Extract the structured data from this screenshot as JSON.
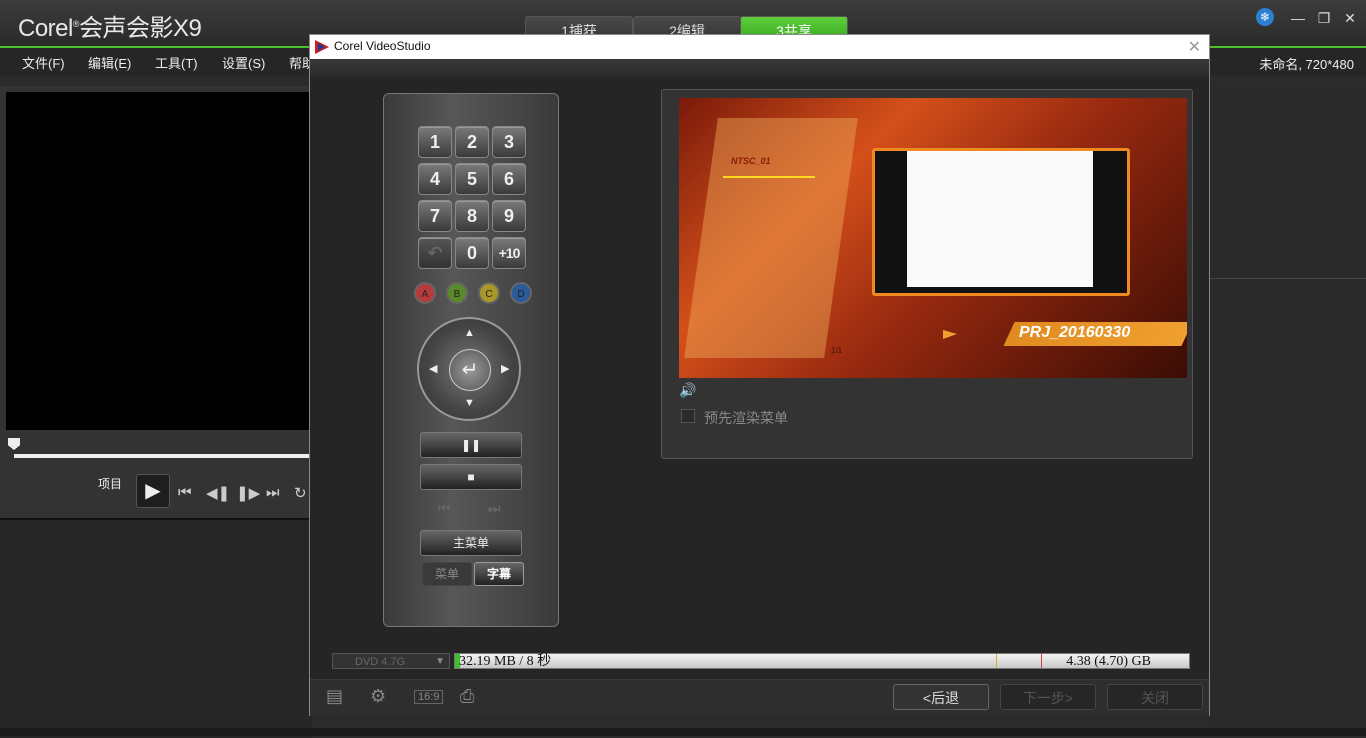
{
  "app": {
    "logo": "Corel",
    "logo_mark": "®",
    "logo_product": "会声会影X9",
    "project_info": "未命名, 720*480",
    "steps": [
      "1捕获",
      "2编辑",
      "3共享"
    ]
  },
  "menu": [
    "文件(F)",
    "编辑(E)",
    "工具(T)",
    "设置(S)",
    "帮助"
  ],
  "window_controls": {
    "snow": "❄",
    "minimize": "—",
    "restore": "❐",
    "close": "✕"
  },
  "left_panel": {
    "project_label": "项目",
    "play": "▶",
    "transport": [
      "⏮",
      "◀❚",
      "❚▶",
      "⏭",
      "↻"
    ]
  },
  "dialog": {
    "title": "Corel VideoStudio",
    "close": "✕",
    "remote": {
      "keys": [
        "1",
        "2",
        "3",
        "4",
        "5",
        "6",
        "7",
        "8",
        "9",
        "↶",
        "0",
        "+10"
      ],
      "color_buttons": [
        {
          "label": "A",
          "color": "#b83a3a"
        },
        {
          "label": "B",
          "color": "#5a8a2a"
        },
        {
          "label": "C",
          "color": "#a8982a"
        },
        {
          "label": "D",
          "color": "#2a5a9a"
        }
      ],
      "enter": "↵",
      "arrows": [
        "▲",
        "▼",
        "◀",
        "▶"
      ],
      "pause": "❚❚",
      "stop": "■",
      "prev_chapter": "⏮",
      "next_chapter": "⏭",
      "main_menu": "主菜单",
      "menu": "菜单",
      "subtitle": "字幕"
    },
    "preview": {
      "ntsc_label": "NTSC_01",
      "page": "1/1",
      "project_title": "PRJ_20160330",
      "volume_icon": "🔊",
      "prerender_label": "预先渲染菜单",
      "prerender_checked": false
    },
    "capacity": {
      "disc_type": "DVD 4.7G",
      "used": "32.19 MB / 8 秒",
      "total": "4.38 (4.70) GB",
      "used_fraction": 0.007
    },
    "footer": {
      "icons": [
        "menu-settings-icon",
        "gear-icon",
        "aspect-ratio-icon",
        "burn-icon"
      ],
      "aspect_text": "16:9",
      "back": "<后退",
      "next": "下一步>",
      "close": "关闭"
    }
  }
}
